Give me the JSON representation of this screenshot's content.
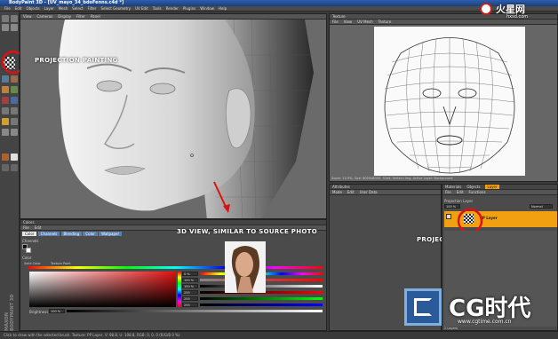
{
  "window": {
    "title": "BodyPaint 3D - [UV_mayo_34_bdoFenns.c4d *]"
  },
  "menu": [
    "File",
    "Edit",
    "Objects",
    "Layer",
    "Mesh",
    "Select",
    "Filter",
    "Select Geometry",
    "UV Edit",
    "Tools",
    "Render",
    "Plugins",
    "Window",
    "Help"
  ],
  "view3d": {
    "menu": [
      "View",
      "Cameras",
      "Display",
      "Filter",
      "Panel"
    ],
    "label": "Parallel"
  },
  "texture_view": {
    "title": "Texture",
    "menu": [
      "File",
      "View",
      "UV Mesh",
      "Texture"
    ],
    "status": "Zoom: 10.9%, Size: 8000x6000, 32bit, Vertex=Img, Active Layer: Background"
  },
  "annotations": {
    "projection_painting": "PROJECTION PAINTING",
    "view_3d": "3D VIEW, SIMILAR TO SOURCE PHOTO",
    "projection_layer": "PROJECTION LAYER CREATED"
  },
  "colors_panel": {
    "title": "Colors",
    "menu": [
      "File",
      "Edit"
    ],
    "tabs": [
      "Color",
      "Channels",
      "Blending",
      "Color",
      "Wallpaper"
    ],
    "channels_label": "Channels",
    "color_label": "Color",
    "subtabs": [
      "Solid Color",
      "Texture Paint"
    ],
    "values": [
      "0 %",
      "100 %",
      "100 %",
      "255",
      "255",
      "255"
    ],
    "brightness_label": "Brightness",
    "brightness_value": "100 %"
  },
  "attributes": {
    "title": "Attributes",
    "menu": [
      "Mode",
      "Edit",
      "User Data"
    ]
  },
  "layers": {
    "tabs": [
      "Materials",
      "Objects",
      "Layer"
    ],
    "menu": [
      "File",
      "Edit",
      "Functions"
    ],
    "section": "Projection Layer",
    "opacity": "100 %",
    "blend_mode": "Normal",
    "layer_name": "PP Layer",
    "layer_count": "2 Layers"
  },
  "status_bar": "Click to draw with the selected brush. Texture: PP Layer, V: 98.8, U: 108.8, RGB: 0, 0, 0 (R/G/B 0 %)",
  "watermark_top": {
    "brand": "火星网",
    "url": "hxsd.com"
  },
  "watermark_bottom": {
    "brand": "CG时代",
    "url": "www.cgtime.com.cn"
  },
  "side_text": "MAXON BODYPAINT 3D",
  "colors": {
    "accent_orange": "#f0a010",
    "annotation_red": "#e01010",
    "title_blue": "#2b5fae"
  }
}
